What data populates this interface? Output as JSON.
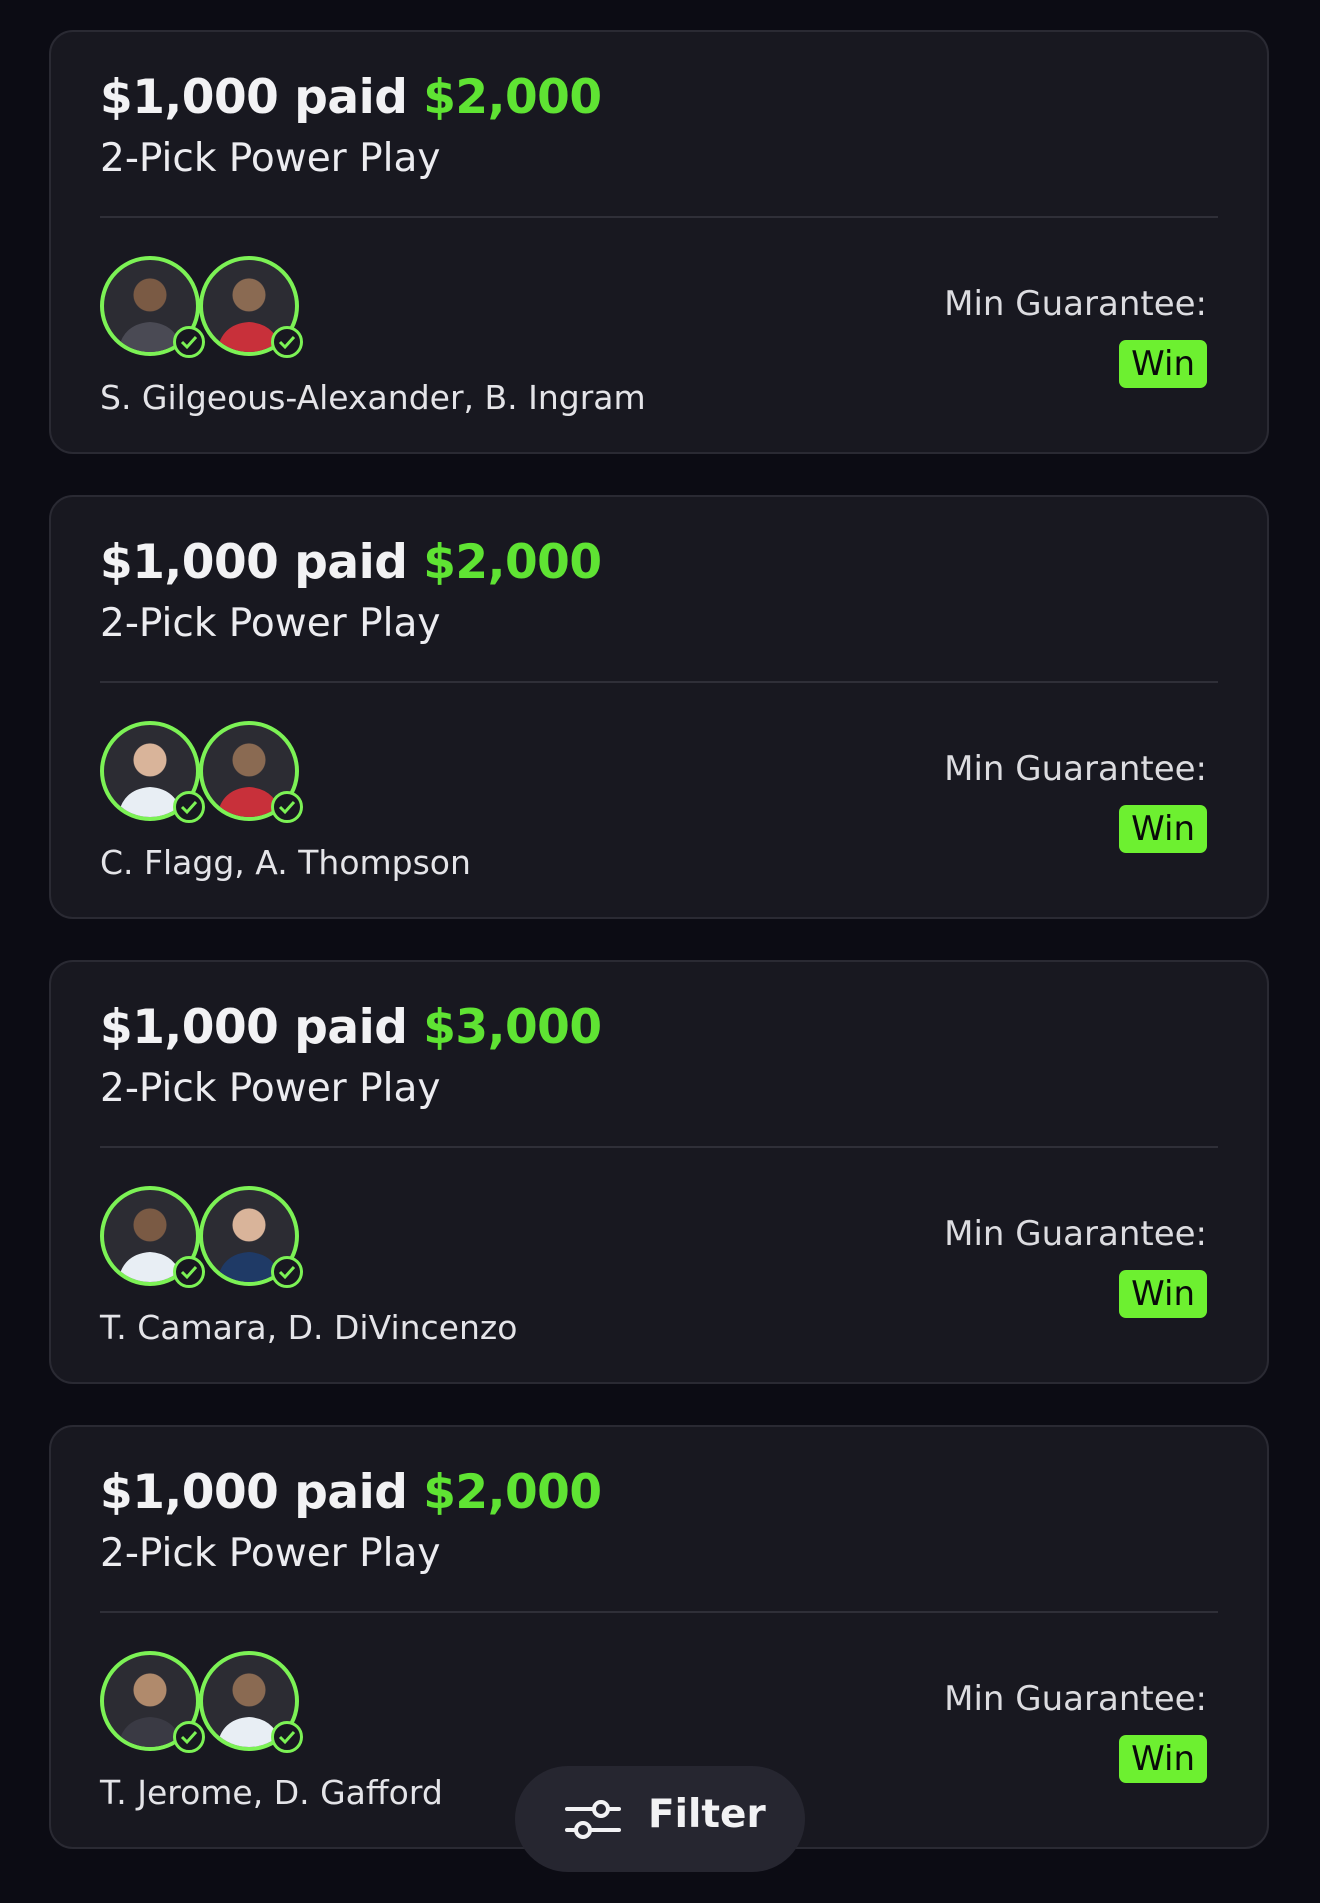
{
  "entries": [
    {
      "stake": "$1,000 paid",
      "payout": "$2,000",
      "play_type": "2-Pick Power Play",
      "players": "S. Gilgeous-Alexander, B. Ingram",
      "min_label": "Min Guarantee:",
      "badge": "Win"
    },
    {
      "stake": "$1,000 paid",
      "payout": "$2,000",
      "play_type": "2-Pick Power Play",
      "players": "C. Flagg, A. Thompson",
      "min_label": "Min Guarantee:",
      "badge": "Win"
    },
    {
      "stake": "$1,000 paid",
      "payout": "$3,000",
      "play_type": "2-Pick Power Play",
      "players": "T. Camara, D. DiVincenzo",
      "min_label": "Min Guarantee:",
      "badge": "Win"
    },
    {
      "stake": "$1,000 paid",
      "payout": "$2,000",
      "play_type": "2-Pick Power Play",
      "players": "T. Jerome, D. Gafford",
      "min_label": "Min Guarantee:",
      "badge": "Win"
    }
  ],
  "filter_button": {
    "label": "Filter",
    "icon": "sliders-icon"
  },
  "icons": {
    "check": "check-circle-icon",
    "avatar": "player-avatar"
  },
  "colors": {
    "background": "#0c0c14",
    "card": "#181820",
    "accent_green": "#5fe333",
    "badge_green": "#6df030"
  }
}
